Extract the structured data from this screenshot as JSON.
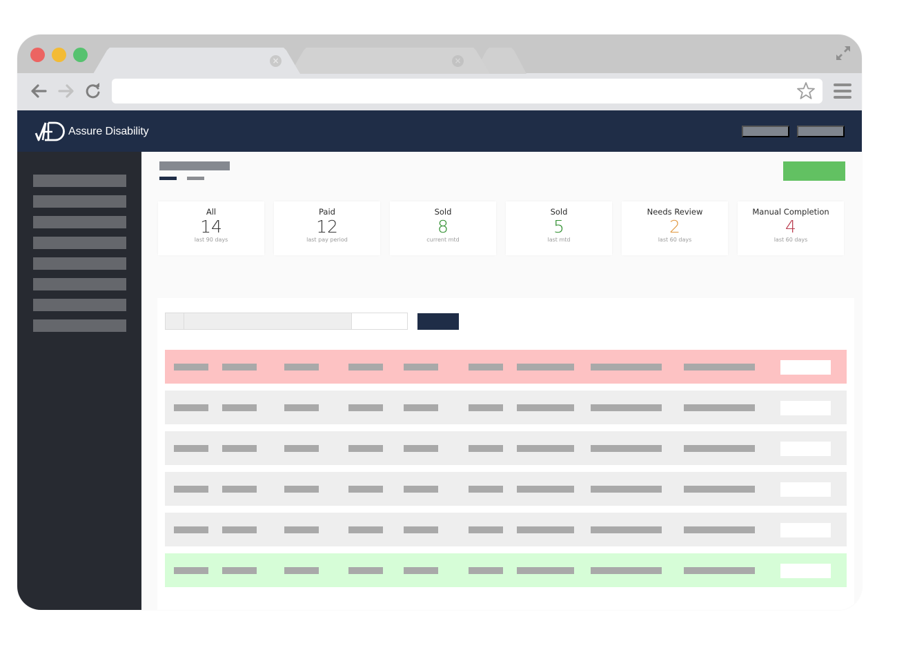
{
  "browser": {
    "tabs": [
      {
        "label": "",
        "active": true
      },
      {
        "label": "",
        "active": false
      },
      {
        "label": "",
        "active": false
      }
    ],
    "address_bar": {
      "value": "",
      "placeholder": ""
    },
    "icons": {
      "back": "arrow-left",
      "forward": "arrow-right",
      "reload": "reload",
      "bookmark": "star-outline",
      "menu": "hamburger",
      "fullscreen": "expand-arrows"
    }
  },
  "app": {
    "brand": "Assure Disability",
    "logo_glyph": "AD",
    "colors": {
      "header": "#1f2d47",
      "sidebar": "#272a31",
      "primary_action": "#62c162",
      "search_button": "#1f2d47",
      "flagged_row": "#fdc2c3",
      "success_row": "#d6fdd7",
      "default_row": "#eeeeee"
    }
  },
  "header": {
    "buttons": [
      {
        "label": ""
      },
      {
        "label": ""
      }
    ]
  },
  "sidebar": {
    "items": [
      {
        "label": ""
      },
      {
        "label": ""
      },
      {
        "label": ""
      },
      {
        "label": ""
      },
      {
        "label": ""
      },
      {
        "label": ""
      },
      {
        "label": ""
      },
      {
        "label": ""
      }
    ]
  },
  "stats": [
    {
      "label": "All",
      "value": "14",
      "sub": "last 90 days",
      "color": "#333333"
    },
    {
      "label": "Paid",
      "value": "12",
      "sub": "last pay period",
      "color": "#333333"
    },
    {
      "label": "Sold",
      "value": "8",
      "sub": "current mtd",
      "color": "#2f8f2f"
    },
    {
      "label": "Sold",
      "value": "5",
      "sub": "last mtd",
      "color": "#2f8f2f"
    },
    {
      "label": "Needs Review",
      "value": "2",
      "sub": "last 60 days",
      "color": "#e0953a"
    },
    {
      "label": "Manual Completion",
      "value": "4",
      "sub": "last 60 days",
      "color": "#b8374a"
    }
  ],
  "table": {
    "search": {
      "value": "",
      "placeholder": ""
    },
    "search_button_label": "",
    "rows": [
      {
        "status": "flagged"
      },
      {
        "status": "default"
      },
      {
        "status": "default"
      },
      {
        "status": "default"
      },
      {
        "status": "default"
      },
      {
        "status": "success"
      }
    ]
  }
}
